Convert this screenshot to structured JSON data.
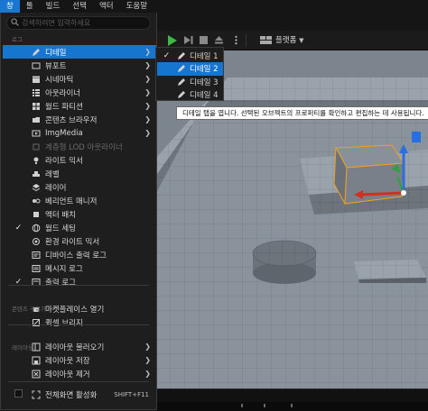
{
  "menubar": {
    "items": [
      "창",
      "툴",
      "빌드",
      "선택",
      "액터",
      "도움말"
    ],
    "active_index": 0
  },
  "search": {
    "placeholder": "검색하려면 입력하세요"
  },
  "sections": {
    "level": "로그",
    "content_browser": "콘텐츠 구독기",
    "layout": "레이아웃"
  },
  "menu_items": [
    {
      "label": "디테일",
      "icon": "pencil-icon",
      "submenu": true,
      "highlighted": true
    },
    {
      "label": "뷰포트",
      "icon": "viewport-icon",
      "submenu": true
    },
    {
      "label": "시네마틱",
      "icon": "clapper-icon",
      "submenu": true
    },
    {
      "label": "아웃라이너",
      "icon": "outliner-icon",
      "submenu": true
    },
    {
      "label": "월드 파티션",
      "icon": "grid-icon",
      "submenu": true
    },
    {
      "label": "콘텐츠 브라우저",
      "icon": "folder-icon",
      "submenu": true
    },
    {
      "label": "ImgMedia",
      "icon": "media-icon",
      "submenu": true
    },
    {
      "label": "계층형 LOD 아웃라이너",
      "icon": "hlod-icon",
      "disabled": true
    },
    {
      "label": "라이트 믹서",
      "icon": "light-icon"
    },
    {
      "label": "레벨",
      "icon": "level-icon"
    },
    {
      "label": "레이어",
      "icon": "layers-icon"
    },
    {
      "label": "베리언트 매니저",
      "icon": "variant-icon"
    },
    {
      "label": "액터 배치",
      "icon": "actor-icon"
    },
    {
      "label": "월드 세팅",
      "icon": "globe-icon",
      "checked": true
    },
    {
      "label": "환경 라이트 믹서",
      "icon": "env-light-icon"
    },
    {
      "label": "디바이스 출력 로그",
      "icon": "device-log-icon"
    },
    {
      "label": "메시지 로그",
      "icon": "message-log-icon"
    },
    {
      "label": "출력 로그",
      "icon": "output-log-icon",
      "checked": true
    },
    {
      "label": "마켓플레이스 열기",
      "icon": "marketplace-icon"
    },
    {
      "label": "퀵셀 브리지",
      "icon": "quixel-icon"
    },
    {
      "label": "레이아웃 불러오기",
      "icon": "layout-icon",
      "submenu": true
    },
    {
      "label": "레이아웃 저장",
      "icon": "layout-save-icon",
      "submenu": true
    },
    {
      "label": "레이아웃 제거",
      "icon": "layout-remove-icon",
      "submenu": true
    },
    {
      "label": "전체화면 활성화",
      "icon": "fullscreen-icon",
      "shortcut": "SHIFT+F11",
      "checkbox": true
    }
  ],
  "submenu": {
    "items": [
      {
        "label": "디테일 1",
        "checked": true
      },
      {
        "label": "디테일 2",
        "highlighted": true
      },
      {
        "label": "디테일 3"
      },
      {
        "label": "디테일 4"
      }
    ]
  },
  "tooltip": {
    "text": "디테일 탭을 엽니다. 선택된 오브젝트의 프로퍼티를 확인하고 편집하는 데 사용됩니다."
  },
  "toolbar": {
    "platform_label": "플랫폼"
  },
  "colors": {
    "accent": "#1675cf",
    "play": "#3fb943",
    "selection": "#f0a020"
  }
}
